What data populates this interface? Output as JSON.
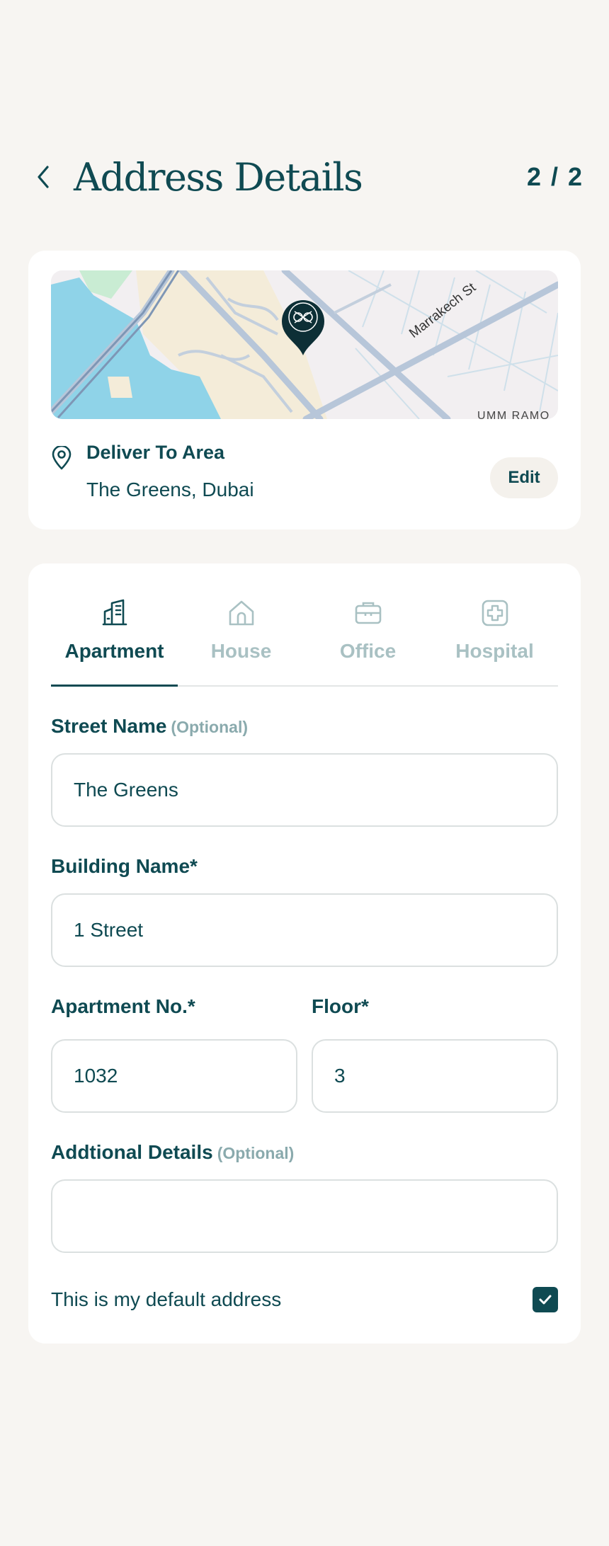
{
  "header": {
    "title": "Address Details",
    "step": "2 / 2",
    "back_icon": "chevron-left-icon"
  },
  "location": {
    "map_street_label": "Marrakech St",
    "map_area_label": "UMM RAMO",
    "deliver_label": "Deliver To Area",
    "area": "The Greens, Dubai",
    "edit_label": "Edit"
  },
  "tabs": [
    {
      "label": "Apartment",
      "icon": "apartment-building-icon",
      "active": true
    },
    {
      "label": "House",
      "icon": "house-icon",
      "active": false
    },
    {
      "label": "Office",
      "icon": "briefcase-icon",
      "active": false
    },
    {
      "label": "Hospital",
      "icon": "hospital-cross-icon",
      "active": false
    }
  ],
  "form": {
    "street_name": {
      "label": "Street Name",
      "optional": "(Optional)",
      "value": "The Greens"
    },
    "building_name": {
      "label": "Building Name*",
      "value": "1 Street"
    },
    "apartment_no": {
      "label": "Apartment No.*",
      "value": "1032"
    },
    "floor": {
      "label": "Floor*",
      "value": "3"
    },
    "additional_details": {
      "label": "Addtional Details",
      "optional": "(Optional)",
      "value": ""
    },
    "default_address": {
      "label": "This is my default address",
      "checked": true
    }
  },
  "colors": {
    "primary": "#0f4a52",
    "inactive": "#a9c1c3",
    "background": "#f7f5f2",
    "water": "#8fd3e8"
  }
}
